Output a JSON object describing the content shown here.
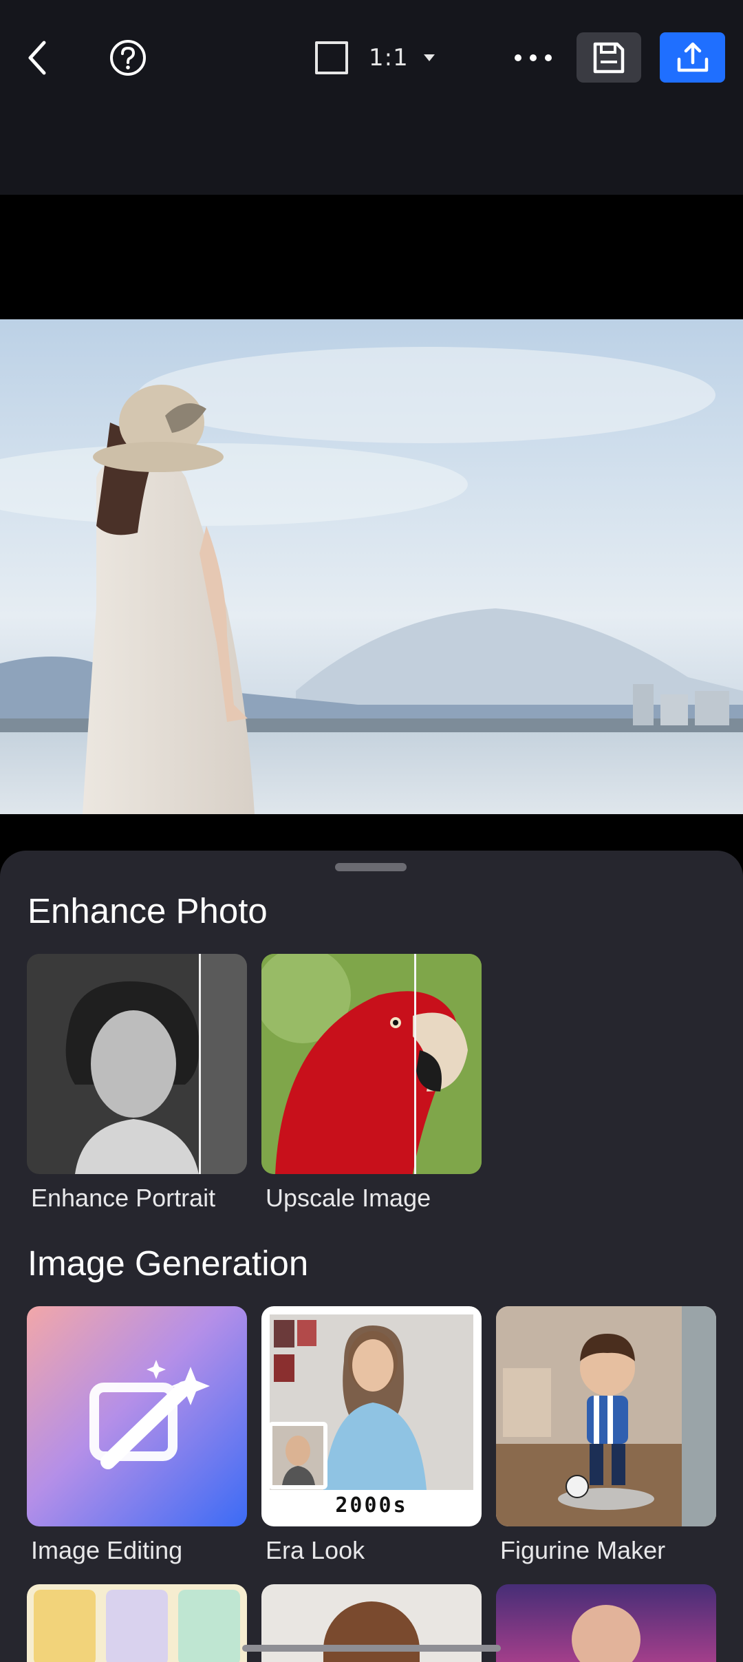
{
  "toolbar": {
    "aspect_ratio_label": "1:1",
    "back_icon": "chevron-left-icon",
    "help_icon": "question-circle-icon",
    "more_icon": "more-horizontal-icon",
    "save_icon": "floppy-disk-icon",
    "export_icon": "upload-icon",
    "accent_color": "#1f6fff"
  },
  "sections": {
    "enhance": {
      "title": "Enhance Photo",
      "items": [
        {
          "label": "Enhance Portrait"
        },
        {
          "label": "Upscale Image"
        }
      ]
    },
    "generation": {
      "title": "Image Generation",
      "items": [
        {
          "label": "Image Editing"
        },
        {
          "label": "Era Look",
          "badge": "2000s"
        },
        {
          "label": "Figurine Maker"
        }
      ]
    }
  }
}
